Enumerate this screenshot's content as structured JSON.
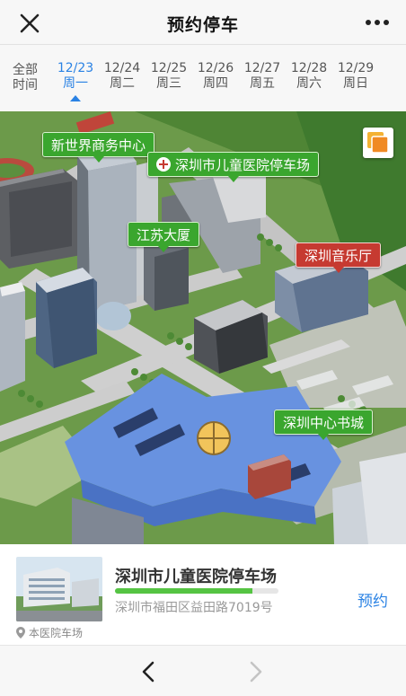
{
  "header": {
    "title": "预约停车",
    "close_icon": "close-icon",
    "more_icon": "more-icon"
  },
  "dates": {
    "all_line1": "全部",
    "all_line2": "时间",
    "days": [
      {
        "date": "12/23",
        "weekday": "周一",
        "selected": true
      },
      {
        "date": "12/24",
        "weekday": "周二"
      },
      {
        "date": "12/25",
        "weekday": "周三"
      },
      {
        "date": "12/26",
        "weekday": "周四"
      },
      {
        "date": "12/27",
        "weekday": "周五"
      },
      {
        "date": "12/28",
        "weekday": "周六"
      },
      {
        "date": "12/29",
        "weekday": "周日"
      }
    ]
  },
  "map": {
    "labels": {
      "xinshijie": "新世界商务中心",
      "hospital": "深圳市儿童医院停车场",
      "jiangsu": "江苏大厦",
      "music_hall": "深圳音乐厅",
      "book_city": "深圳中心书城"
    },
    "layers_icon": "layers-icon"
  },
  "parking": {
    "name": "深圳市儿童医院停车场",
    "address": "深圳市福田区益田路7019号",
    "reserve_label": "预约",
    "tag": "本医院车场",
    "availability_fraction": 0.84,
    "accent": "#2a82e4",
    "bar_color": "#55c443"
  },
  "nav": {
    "back_icon": "chevron-left-icon",
    "forward_icon": "chevron-right-icon"
  }
}
